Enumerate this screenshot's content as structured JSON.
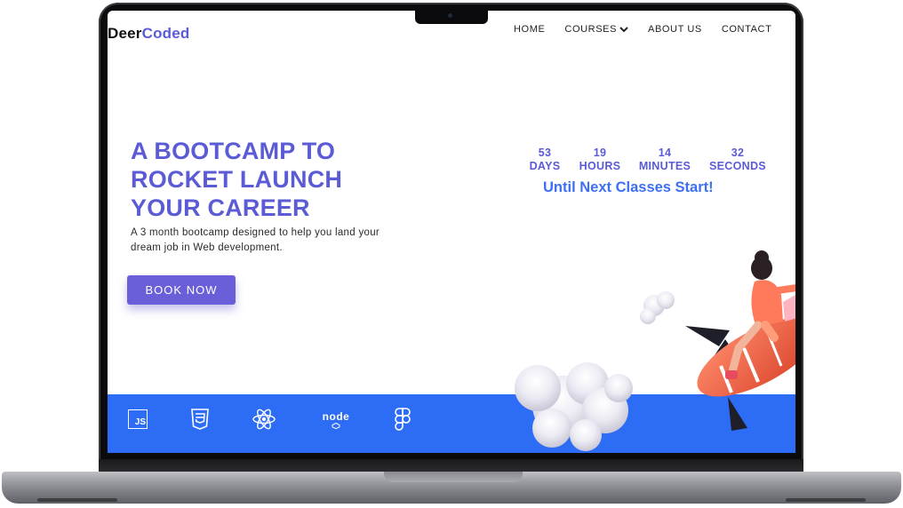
{
  "brand": {
    "part1": "Deer",
    "part2": "Coded"
  },
  "nav": {
    "home": "HOME",
    "courses": "COURSES",
    "about": "ABOUT US",
    "contact": "CONTACT"
  },
  "hero": {
    "title_line1": "A BOOTCAMP TO",
    "title_line2": "ROCKET LAUNCH",
    "title_line3": "YOUR CAREER",
    "subtitle_line1": "A 3 month bootcamp designed to help you land your",
    "subtitle_line2": "dream job in Web development.",
    "cta_label": "BOOK NOW"
  },
  "countdown": {
    "units": [
      {
        "value": "53",
        "label": "DAYS"
      },
      {
        "value": "19",
        "label": "HOURS"
      },
      {
        "value": "14",
        "label": "MINUTES"
      },
      {
        "value": "32",
        "label": "SECONDS"
      }
    ],
    "caption": "Until Next Classes Start!"
  },
  "tech": {
    "js_label": "JS",
    "node_label": "node",
    "icons": [
      "javascript-icon",
      "css3-icon",
      "react-icon",
      "nodejs-icon",
      "figma-icon"
    ]
  },
  "colors": {
    "accent": "#5b5bd6",
    "strip": "#2d6cf4",
    "caption": "#3d6ff0",
    "button": "#6a5fd8"
  }
}
